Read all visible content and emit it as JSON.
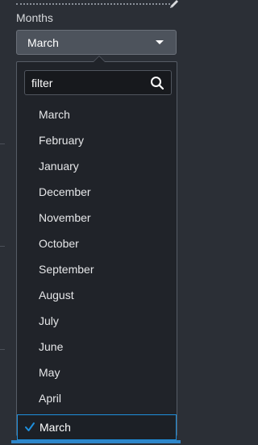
{
  "field": {
    "label": "Months"
  },
  "select": {
    "value": "March"
  },
  "filter": {
    "placeholder": "filter",
    "value": ""
  },
  "options": [
    "March",
    "February",
    "January",
    "December",
    "November",
    "October",
    "September",
    "August",
    "July",
    "June",
    "May",
    "April"
  ],
  "selected_option": "March",
  "icons": {
    "edit": "pencil-icon",
    "caret": "caret-down-icon",
    "search": "search-icon",
    "check": "check-icon"
  },
  "colors": {
    "accent": "#1e8fdc",
    "background": "#2b2f36",
    "dropdown_background": "#202329"
  }
}
